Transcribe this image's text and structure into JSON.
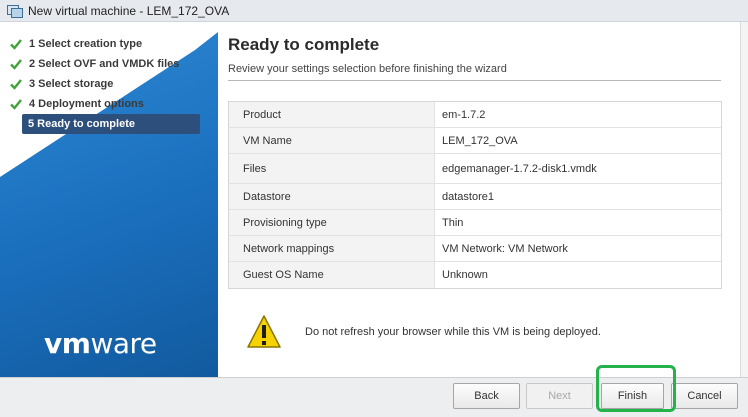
{
  "window": {
    "title": "New virtual machine - LEM_172_OVA"
  },
  "sidebar": {
    "steps": [
      {
        "label": "1  Select creation type",
        "status": "done"
      },
      {
        "label": "2  Select OVF and VMDK files",
        "status": "done"
      },
      {
        "label": "3  Select storage",
        "status": "done"
      },
      {
        "label": "4  Deployment options",
        "status": "done"
      },
      {
        "label": "5  Ready to complete",
        "status": "active"
      }
    ],
    "logo": {
      "vm": "vm",
      "ware": "ware"
    },
    "colors": {
      "gradient_top": "#2f8ad6",
      "gradient_bottom": "#125a9f",
      "active_step": "#2c4f7c",
      "check": "#3fa33a"
    }
  },
  "main": {
    "title": "Ready to complete",
    "subtitle": "Review your settings selection before finishing the wizard",
    "summary": [
      {
        "key": "Product",
        "value": "em-1.7.2"
      },
      {
        "key": "VM Name",
        "value": "LEM_172_OVA"
      },
      {
        "key": "Files",
        "value": "edgemanager-1.7.2-disk1.vmdk"
      },
      {
        "key": "Datastore",
        "value": "datastore1"
      },
      {
        "key": "Provisioning type",
        "value": "Thin"
      },
      {
        "key": "Network mappings",
        "value": "VM Network: VM Network"
      },
      {
        "key": "Guest OS Name",
        "value": "Unknown"
      }
    ],
    "warning": {
      "icon": "warning-icon",
      "text": "Do not refresh your browser while this VM is being deployed."
    }
  },
  "footer": {
    "back_label": "Back",
    "next_label": "Next",
    "finish_label": "Finish",
    "cancel_label": "Cancel",
    "highlight_color": "#24b24a"
  }
}
